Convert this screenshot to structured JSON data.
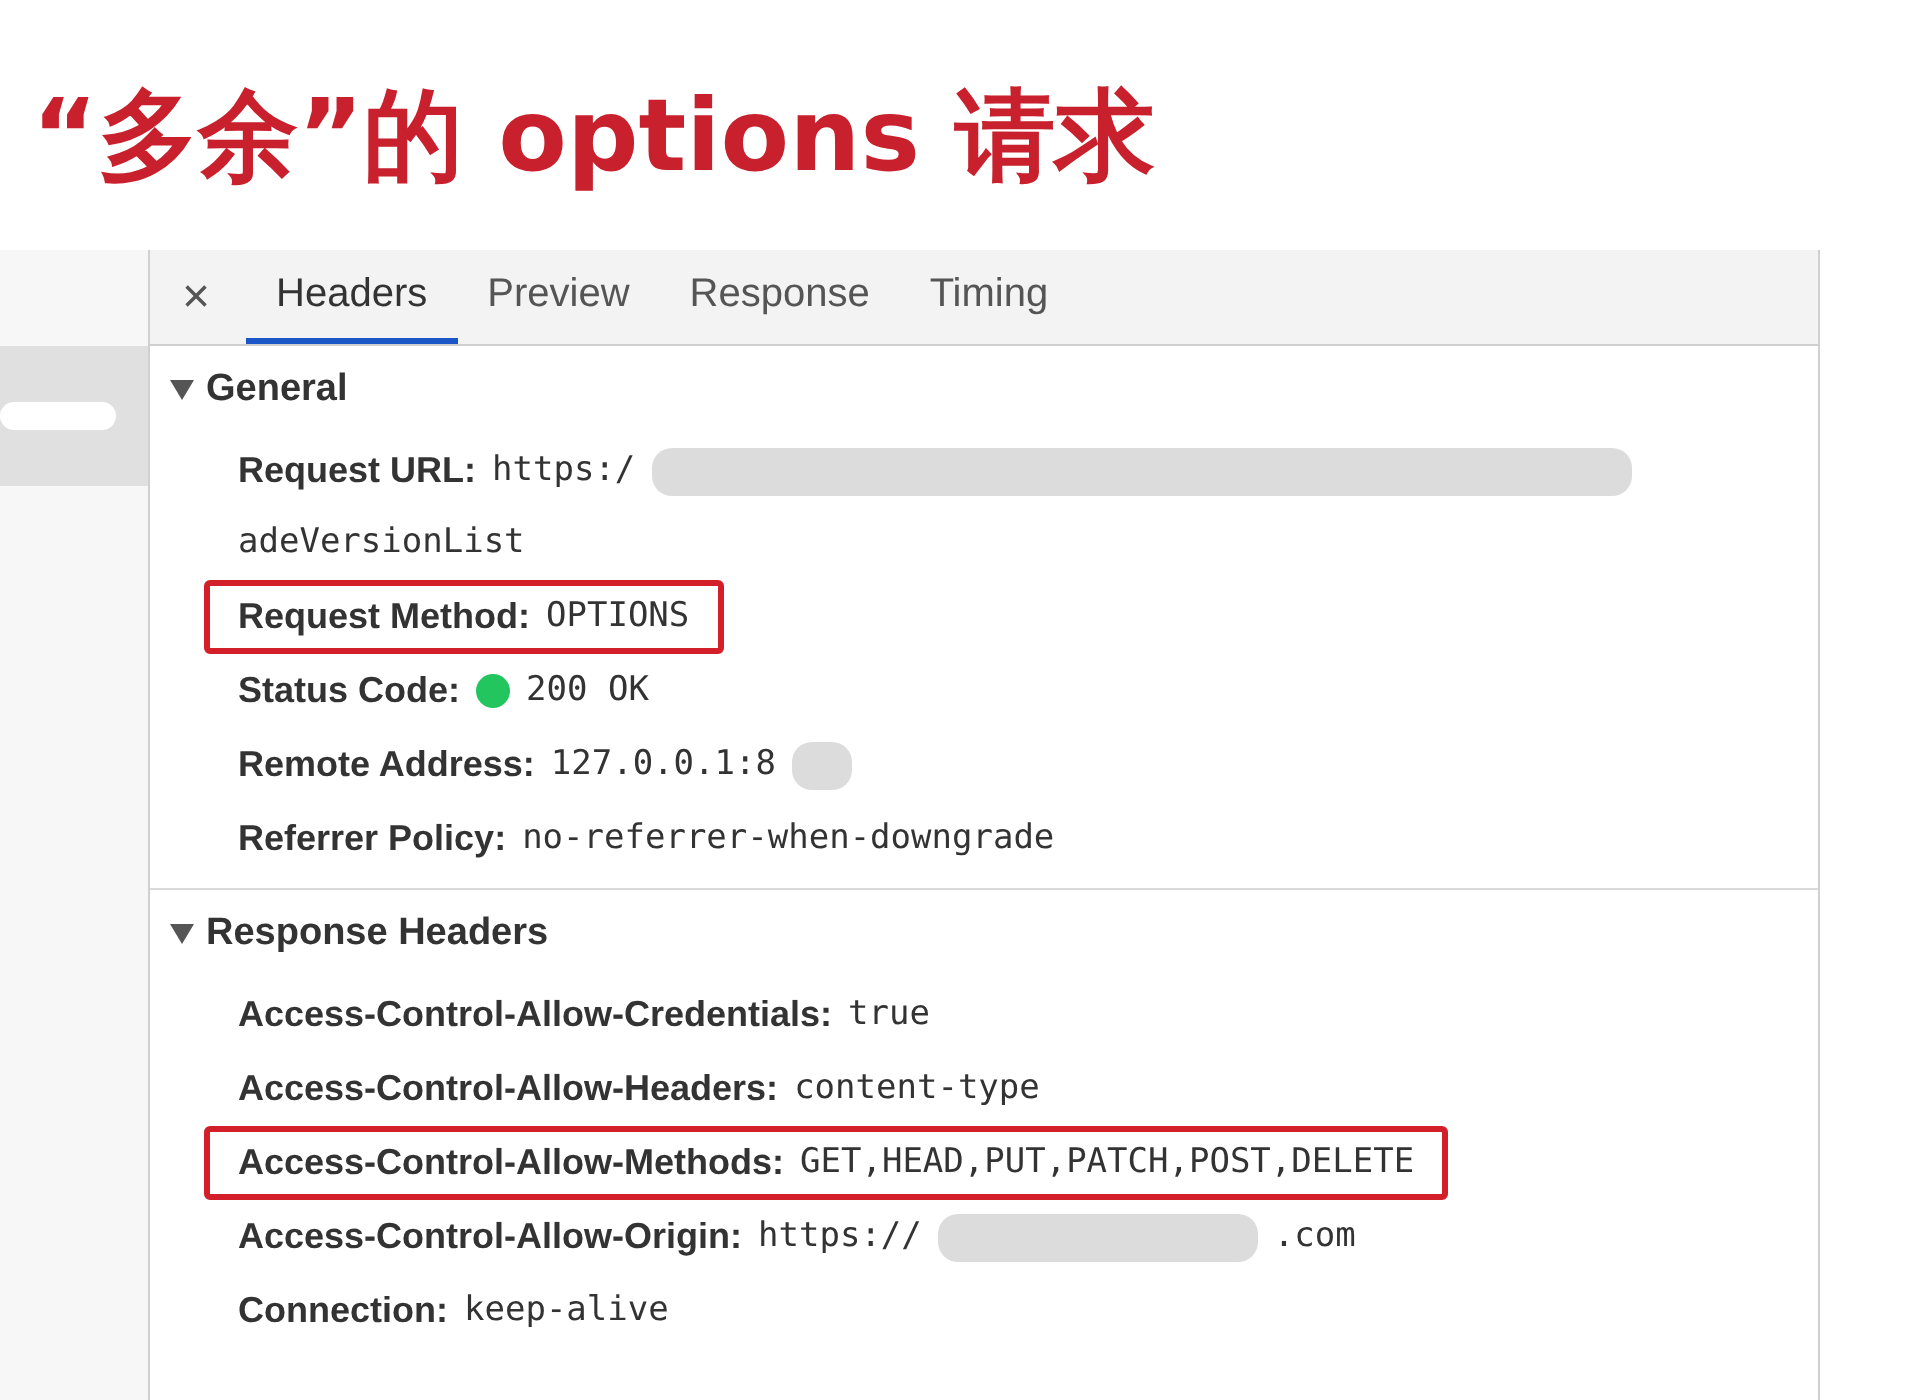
{
  "slide_title": "“多余”的 options 请求",
  "tabs": [
    {
      "label": "Headers",
      "selected": true
    },
    {
      "label": "Preview",
      "selected": false
    },
    {
      "label": "Response",
      "selected": false
    },
    {
      "label": "Timing",
      "selected": false
    }
  ],
  "close_button": "×",
  "sections": [
    {
      "title": "General",
      "expanded": true,
      "rows": [
        {
          "name": "Request URL:",
          "value": "https:/",
          "redacted": true,
          "continuation": "adeVersionList",
          "highlighted": false
        },
        {
          "name": "Request Method:",
          "value": "OPTIONS",
          "highlighted": true
        },
        {
          "name": "Status Code:",
          "value": "200 OK",
          "kind": "status",
          "highlighted": false
        },
        {
          "name": "Remote Address:",
          "value": "127.0.0.1:8",
          "redacted": true,
          "highlighted": false
        },
        {
          "name": "Referrer Policy:",
          "value": "no-referrer-when-downgrade",
          "highlighted": false
        }
      ]
    },
    {
      "title": "Response Headers",
      "expanded": true,
      "rows": [
        {
          "name": "Access-Control-Allow-Credentials:",
          "value": "true",
          "highlighted": false
        },
        {
          "name": "Access-Control-Allow-Headers:",
          "value": "content-type",
          "highlighted": false
        },
        {
          "name": "Access-Control-Allow-Methods:",
          "value": "GET,HEAD,PUT,PATCH,POST,DELETE",
          "highlighted": true
        },
        {
          "name": "Access-Control-Allow-Origin:",
          "value": "https://",
          "redacted": true,
          "value_end": ".com",
          "highlighted": false
        },
        {
          "name": "Connection:",
          "value": "keep-alive",
          "highlighted": false
        }
      ]
    }
  ]
}
